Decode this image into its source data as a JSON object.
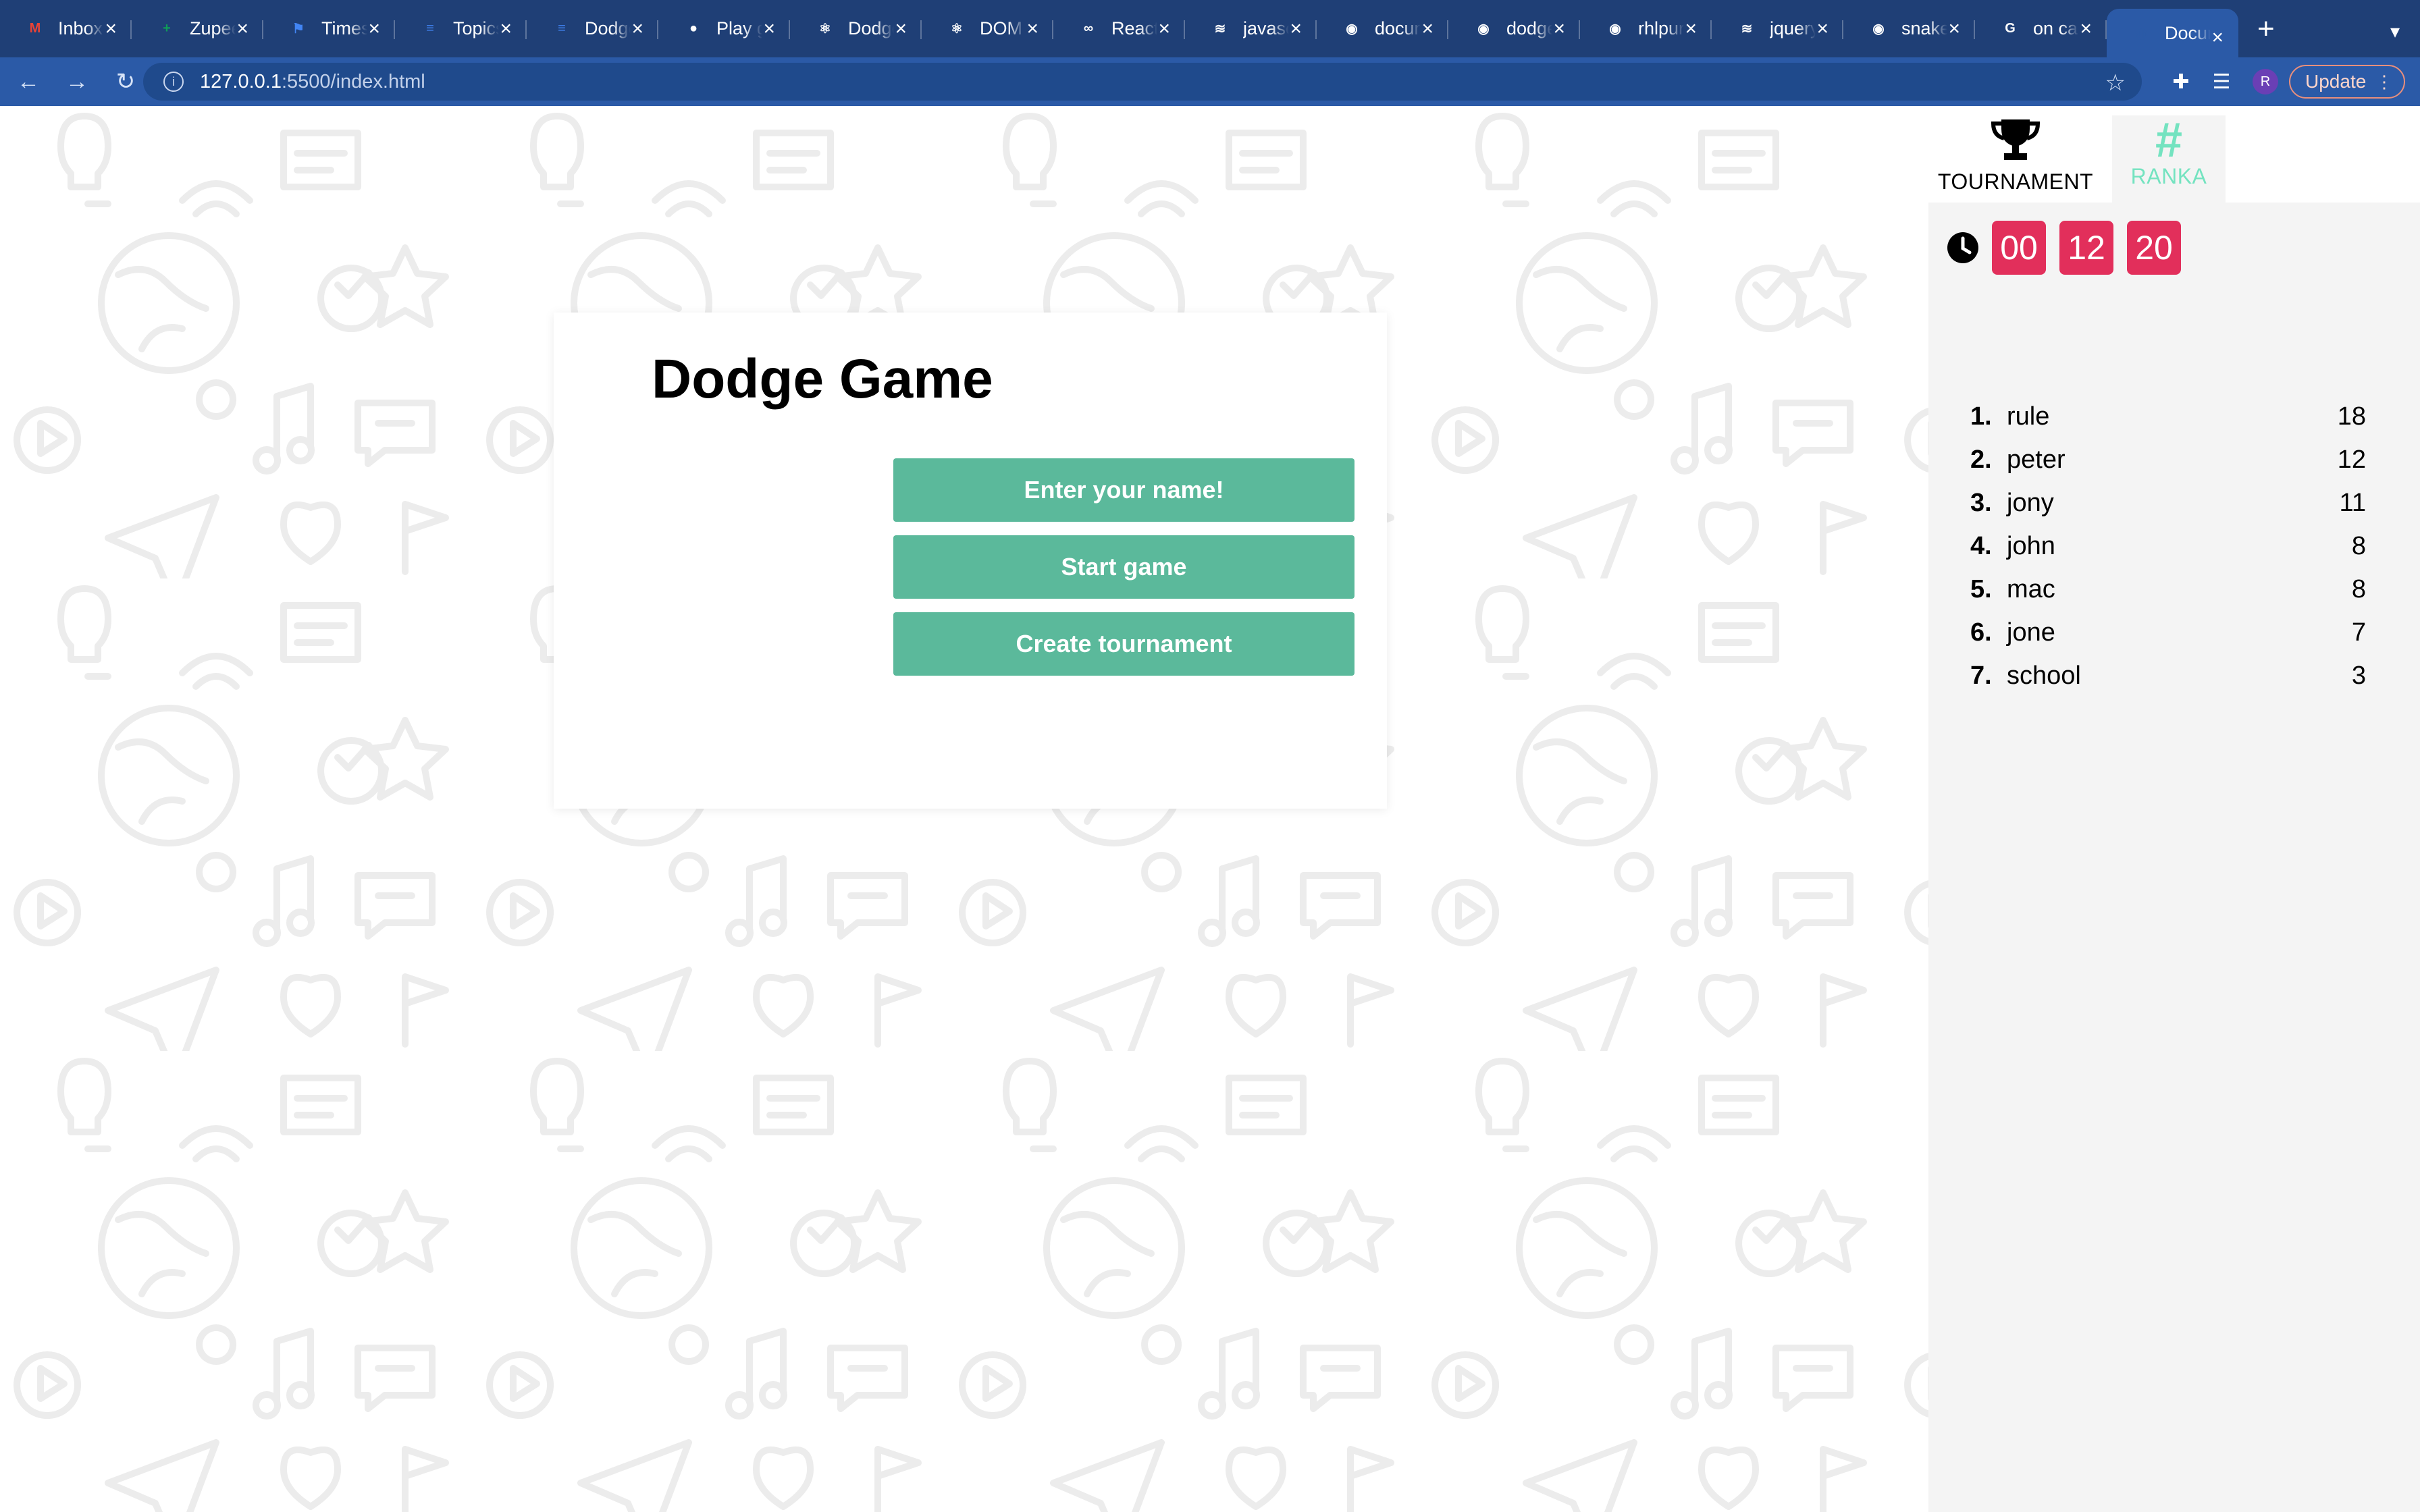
{
  "browser": {
    "tabs": [
      {
        "label": "Inbox",
        "icon": "gmail-icon",
        "color": "#ea4335",
        "glyph": "M"
      },
      {
        "label": "Zupee",
        "icon": "sheets-icon",
        "color": "#0f9d58",
        "glyph": "+"
      },
      {
        "label": "Timesheet",
        "icon": "flag-icon",
        "color": "#4285f4",
        "glyph": "⚑"
      },
      {
        "label": "Topics",
        "icon": "docs-icon",
        "color": "#4285f4",
        "glyph": "≡"
      },
      {
        "label": "Dodge",
        "icon": "docs-icon",
        "color": "#4285f4",
        "glyph": "≡"
      },
      {
        "label": "Play game",
        "icon": "dot-icon",
        "color": "#1f3f76",
        "glyph": "●"
      },
      {
        "label": "Dodge",
        "icon": "react-icon",
        "color": "#1f3f76",
        "glyph": "⚛"
      },
      {
        "label": "DOM",
        "icon": "react-icon",
        "color": "#1f3f76",
        "glyph": "⚛"
      },
      {
        "label": "React",
        "icon": "geeks-icon",
        "color": "#1f3f76",
        "glyph": "∞"
      },
      {
        "label": "javascript",
        "icon": "stack-icon",
        "color": "#1f3f76",
        "glyph": "≋"
      },
      {
        "label": "document",
        "icon": "github-icon",
        "color": "#1f3f76",
        "glyph": "◉"
      },
      {
        "label": "dodge",
        "icon": "github-icon",
        "color": "#1f3f76",
        "glyph": "◉"
      },
      {
        "label": "rhlpur",
        "icon": "github-icon",
        "color": "#1f3f76",
        "glyph": "◉"
      },
      {
        "label": "jquery",
        "icon": "stack-icon",
        "color": "#1f3f76",
        "glyph": "≋"
      },
      {
        "label": "snake",
        "icon": "github-icon",
        "color": "#1f3f76",
        "glyph": "◉"
      },
      {
        "label": "on ca",
        "icon": "google-icon",
        "color": "#ffffff",
        "glyph": "G"
      },
      {
        "label": "Docum",
        "icon": "globe-icon",
        "color": "#2b5aa7",
        "glyph": "◍",
        "active": true
      }
    ],
    "new_tab": "+",
    "tab_search": "▾",
    "url_host": "127.0.0.1",
    "url_path": ":5500/index.html",
    "update_label": "Update",
    "avatar_initial": "R"
  },
  "game": {
    "title": "Dodge Game",
    "buttons": {
      "name": "Enter your name!",
      "start": "Start game",
      "tournament": "Create tournament"
    }
  },
  "sidebar": {
    "tabs": {
      "tournament": "TOURNAMENT",
      "ranka": "RANKA",
      "ranka_glyph": "#"
    },
    "timer": {
      "hours": "00",
      "minutes": "12",
      "seconds": "20"
    },
    "rankings": [
      {
        "rank": "1.",
        "name": "rule",
        "score": "18"
      },
      {
        "rank": "2.",
        "name": "peter",
        "score": "12"
      },
      {
        "rank": "3.",
        "name": "jony",
        "score": "11"
      },
      {
        "rank": "4.",
        "name": "john",
        "score": "8"
      },
      {
        "rank": "5.",
        "name": "mac",
        "score": "8"
      },
      {
        "rank": "6.",
        "name": "jone",
        "score": "7"
      },
      {
        "rank": "7.",
        "name": "school",
        "score": "3"
      }
    ]
  },
  "colors": {
    "chrome": "#1f3f76",
    "toolbar": "#2b5aa7",
    "button": "#5bb99b",
    "timer": "#e22f5b",
    "accent": "#74e3c0"
  }
}
